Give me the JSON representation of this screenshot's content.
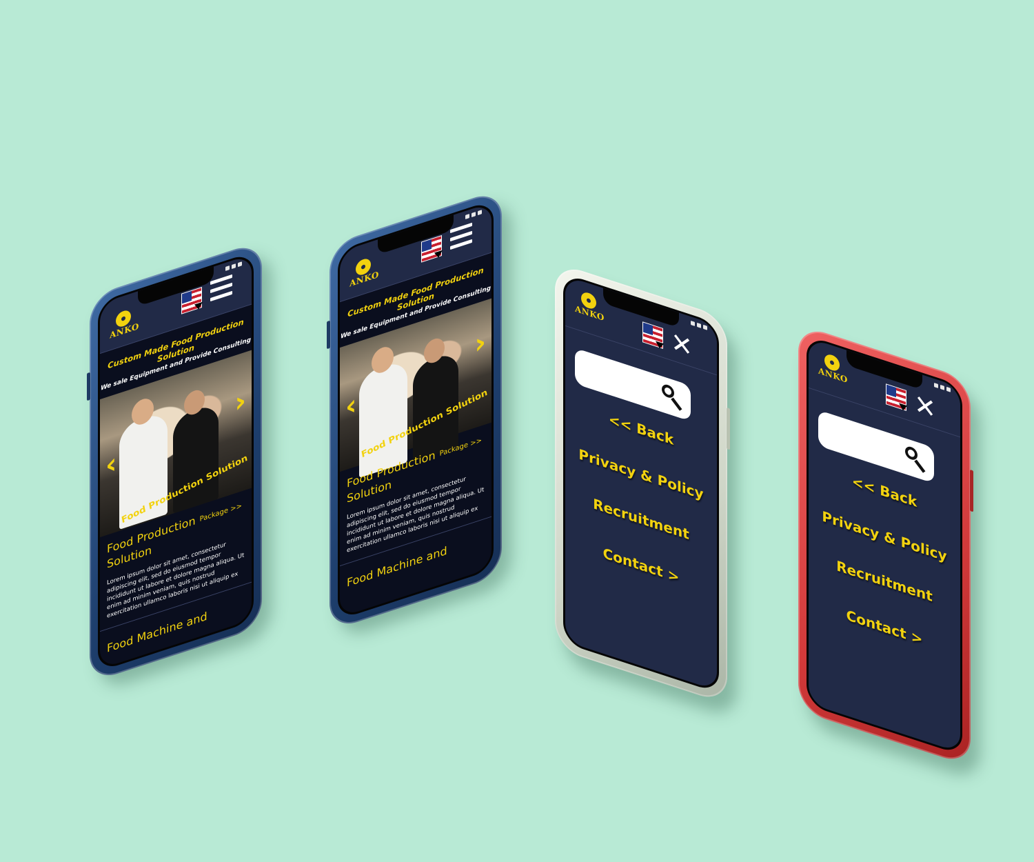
{
  "brand": {
    "logo_text": "ANKO"
  },
  "home": {
    "hero_title": "Custom Made Food Production Solution",
    "hero_subtitle": "We sale Equipment and Provide Consulting",
    "image_caption": "Food Production Solution",
    "section_title": "Food Production Solution",
    "package_link": "Package >>",
    "lorem": "Lorem ipsum dolor sit amet, consectetur adipiscing elit, sed do eiusmod tempor incididunt ut labore et dolore magna aliqua. Ut enim ad minim veniam, quis nostrud exercitation ullamco laboris nisi ut aliquip ex",
    "next_section": "Food Machine and"
  },
  "menu": {
    "back": "<< Back",
    "items": [
      "Privacy & Policy",
      "Recruitment",
      "Contact >"
    ]
  },
  "icons": {
    "language": "us-flag-icon",
    "menu": "hamburger-icon",
    "close": "close-icon",
    "search": "search-icon",
    "prev": "chevron-left-icon",
    "next": "chevron-right-icon"
  },
  "colors": {
    "background": "#b8ead5",
    "accent": "#f2d20f",
    "header": "#212a47",
    "phone_blue": "#2b5288",
    "phone_white": "#e4e8dc",
    "phone_red": "#d23a3a"
  }
}
